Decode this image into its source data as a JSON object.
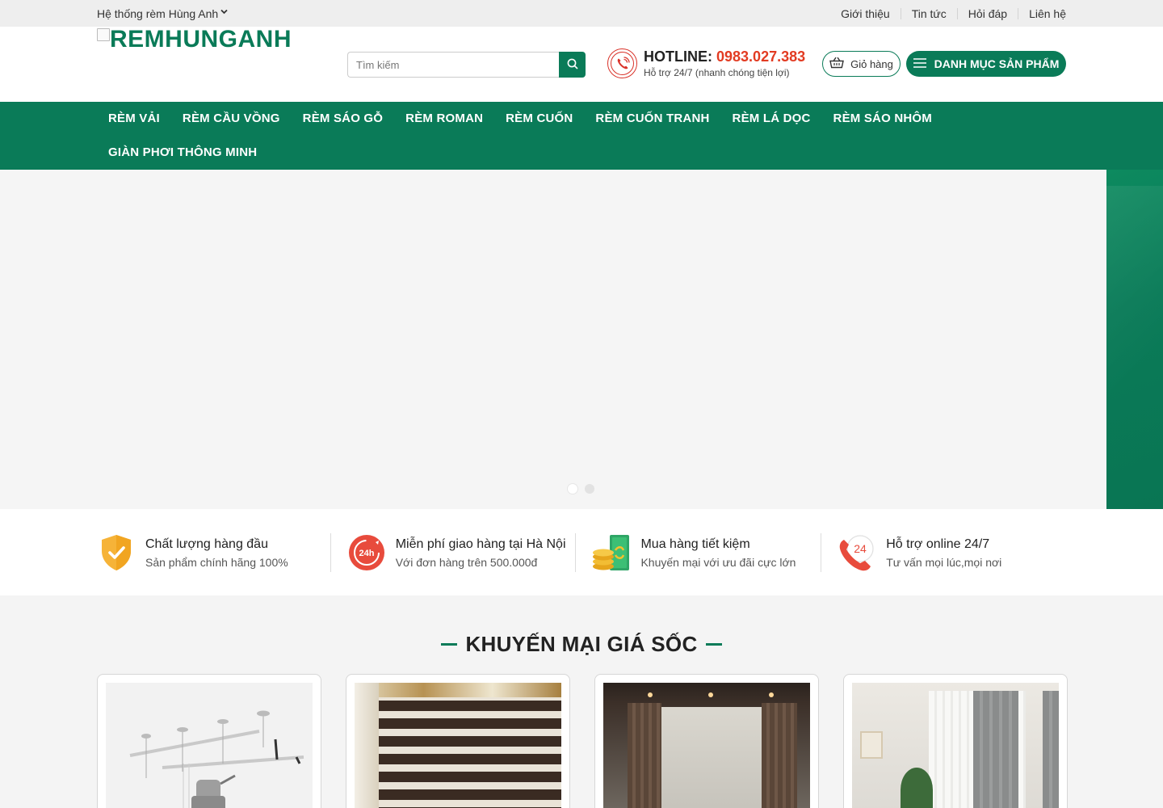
{
  "topbar": {
    "system_label": "Hệ thống rèm Hùng Anh",
    "links": [
      "Giới thiệu",
      "Tin tức",
      "Hỏi đáp",
      "Liên hệ"
    ]
  },
  "header": {
    "logo_alt": "REMHUNGANH",
    "search_placeholder": "Tìm kiếm",
    "hotline_label": "HOTLINE:",
    "hotline_number": "0983.027.383",
    "hotline_sub": "Hỗ trợ 24/7 (nhanh chóng tiện lợi)",
    "cart_label": "Giỏ hàng",
    "category_button": "DANH MỤC SẢN PHẨM"
  },
  "nav": {
    "items": [
      "RÈM VẢI",
      "RÈM CẦU VỒNG",
      "RÈM SÁO GỖ",
      "RÈM ROMAN",
      "RÈM CUỐN",
      "RÈM CUỐN TRANH",
      "RÈM LÁ DỌC",
      "RÈM SÁO NHÔM",
      "GIÀN PHƠI THÔNG MINH"
    ]
  },
  "slider": {
    "active_dot": 1,
    "dot_count": 2
  },
  "features": [
    {
      "icon": "shield-check-icon",
      "title": "Chất lượng hàng đầu",
      "desc": "Sản phẩm chính hãng 100%"
    },
    {
      "icon": "24h-delivery-icon",
      "title": "Miễn phí giao hàng tại Hà Nội",
      "desc": "Với đơn hàng trên 500.000đ"
    },
    {
      "icon": "coins-money-icon",
      "title": "Mua hàng tiết kiệm",
      "desc": "Khuyến mại với ưu đãi cực lớn"
    },
    {
      "icon": "phone-24-icon",
      "title": "Hỗ trợ online 24/7",
      "desc": "Tư vấn mọi lúc,mọi nơi"
    }
  ],
  "promo": {
    "title": "KHUYẾN MẠI GIÁ SỐC"
  },
  "colors": {
    "brand_green": "#0a7b58",
    "hotline_red": "#e23b22"
  }
}
